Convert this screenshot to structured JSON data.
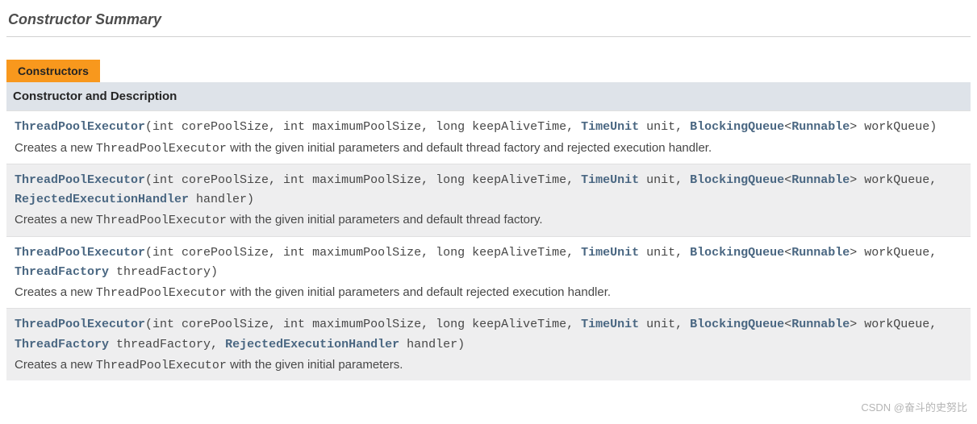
{
  "section_title": "Constructor Summary",
  "caption": "Constructors",
  "header": "Constructor and Description",
  "constructors": [
    {
      "name": "ThreadPoolExecutor",
      "p_open": "(int corePoolSize, int maximumPoolSize, long keepAliveTime, ",
      "p_timeunit": "TimeUnit",
      "p_after_tu": " unit, ",
      "p_bq": "BlockingQueue",
      "p_lt": "<",
      "p_runnable": "Runnable",
      "p_gt_wq": "> workQueue)",
      "desc_pre": "Creates a new ",
      "desc_class": "ThreadPoolExecutor",
      "desc_post": " with the given initial parameters and default thread factory and rejected execution handler."
    },
    {
      "name": "ThreadPoolExecutor",
      "p_open": "(int corePoolSize, int maximumPoolSize, long keepAliveTime, ",
      "p_timeunit": "TimeUnit",
      "p_after_tu": " unit, ",
      "p_bq": "BlockingQueue",
      "p_lt": "<",
      "p_runnable": "Runnable",
      "p_gt_wq": "> workQueue, ",
      "p_extra1": "RejectedExecutionHandler",
      "p_after_extra1": " handler)",
      "desc_pre": "Creates a new ",
      "desc_class": "ThreadPoolExecutor",
      "desc_post": " with the given initial parameters and default thread factory."
    },
    {
      "name": "ThreadPoolExecutor",
      "p_open": "(int corePoolSize, int maximumPoolSize, long keepAliveTime, ",
      "p_timeunit": "TimeUnit",
      "p_after_tu": " unit, ",
      "p_bq": "BlockingQueue",
      "p_lt": "<",
      "p_runnable": "Runnable",
      "p_gt_wq": "> workQueue, ",
      "p_extra1": "ThreadFactory",
      "p_after_extra1": " threadFactory)",
      "desc_pre": "Creates a new ",
      "desc_class": "ThreadPoolExecutor",
      "desc_post": " with the given initial parameters and default rejected execution handler."
    },
    {
      "name": "ThreadPoolExecutor",
      "p_open": "(int corePoolSize, int maximumPoolSize, long keepAliveTime, ",
      "p_timeunit": "TimeUnit",
      "p_after_tu": " unit, ",
      "p_bq": "BlockingQueue",
      "p_lt": "<",
      "p_runnable": "Runnable",
      "p_gt_wq": "> workQueue, ",
      "p_extra1": "ThreadFactory",
      "p_after_extra1": " threadFactory, ",
      "p_extra2": "RejectedExecutionHandler",
      "p_after_extra2": " handler)",
      "desc_pre": "Creates a new ",
      "desc_class": "ThreadPoolExecutor",
      "desc_post": " with the given initial parameters."
    }
  ],
  "watermark": "CSDN @奋斗的史努比"
}
